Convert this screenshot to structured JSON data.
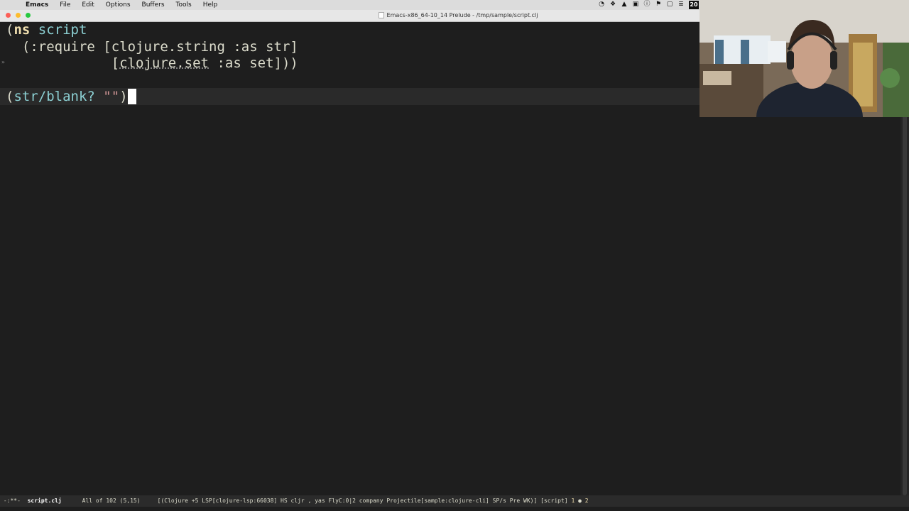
{
  "menubar": {
    "apple_icon": "apple-logo",
    "app": "Emacs",
    "items": [
      "File",
      "Edit",
      "Options",
      "Buffers",
      "Tools",
      "Help"
    ],
    "clock": "20"
  },
  "window": {
    "title": "Emacs-x86_64-10_14 Prelude - /tmp/sample/script.clj",
    "traffic_lights": [
      "#fc5f57",
      "#fdbc2e",
      "#28c840"
    ]
  },
  "editor": {
    "lines": [
      {
        "t1": "(",
        "t2": "ns",
        "t3": " ",
        "t4": "script"
      },
      {
        "t1": "  (",
        "t2": ":require",
        "t3": " [",
        "t4": "clojure.string",
        "t5": " :as ",
        "t6": "str",
        "t7": "]"
      },
      {
        "t1": "             [",
        "t2": "clojure.set",
        "t3": " :as ",
        "t4": "set",
        "t5": "]))"
      },
      {
        "t1": "(",
        "t2": "str/blank?",
        "t3": " ",
        "t4": "\"\"",
        "t5": ")"
      }
    ],
    "colors": {
      "background": "#1e1e1e",
      "current_line": "#2a2a2a",
      "keyword": "#f0dfaf",
      "symbol": "#8cd0d3",
      "string": "#cc9393"
    }
  },
  "modeline": {
    "status": "-:**-",
    "buffer": "script.clj",
    "position": "All of 102",
    "cursor": "(5,15)",
    "modes": "[(Clojure +5 LSP[clojure-lsp:66038] HS cljr , yas FlyC:0|2 company Projectile[sample:clojure-cli] SP/s Pre WK)]",
    "project": "[script]",
    "errors": "1",
    "warnings": "2"
  }
}
